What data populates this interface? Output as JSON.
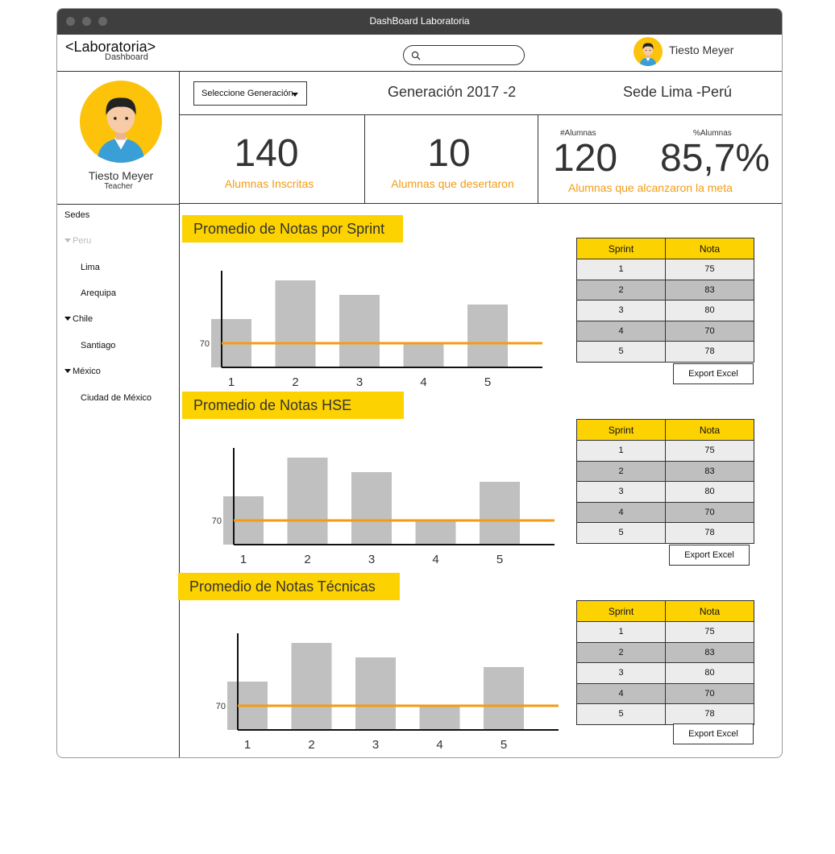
{
  "window": {
    "title": "DashBoard Laboratoria"
  },
  "header": {
    "logo": "<Laboratoria>",
    "logo_sub": "Dashboard",
    "search": {
      "value": "",
      "placeholder": ""
    },
    "user_name": "Tiesto Meyer"
  },
  "sidebar": {
    "profile": {
      "name": "Tiesto Meyer",
      "role": "Teacher"
    },
    "tree": [
      {
        "label": "Sedes",
        "level": 0,
        "expandable": false
      },
      {
        "label": "Peru",
        "level": 0,
        "expandable": true,
        "muted": true
      },
      {
        "label": "Lima",
        "level": 1,
        "expandable": false
      },
      {
        "label": "Arequipa",
        "level": 1,
        "expandable": false
      },
      {
        "label": "Chile",
        "level": 0,
        "expandable": true
      },
      {
        "label": "Santiago",
        "level": 1,
        "expandable": false
      },
      {
        "label": "México",
        "level": 0,
        "expandable": true
      },
      {
        "label": "Ciudad de México",
        "level": 1,
        "expandable": false
      }
    ]
  },
  "toolbar": {
    "select_label": "Seleccione Generación",
    "generation": "Generación 2017 -2",
    "sede": "Sede Lima -Perú"
  },
  "stats": {
    "inscritas": {
      "value": "140",
      "label": "Alumnas Inscritas"
    },
    "desertaron": {
      "value": "10",
      "label": "Alumnas que desertaron"
    },
    "meta": {
      "count_label": "#Alumnas",
      "count": "120",
      "pct_label": "%Alumnas",
      "pct": "85,7%",
      "label": "Alumnas que alcanzaron la meta"
    }
  },
  "colors": {
    "accent": "#fcd200",
    "orange": "#f39c12",
    "bar": "#c0c0c0",
    "titlebar": "#3f3f3f"
  },
  "export_label": "Export Excel",
  "table_headers": [
    "Sprint",
    "Nota"
  ],
  "chart_data": [
    {
      "type": "bar",
      "title": "Promedio de Notas por Sprint",
      "categories": [
        "1",
        "2",
        "3",
        "4",
        "5"
      ],
      "values": [
        75,
        83,
        80,
        70,
        78
      ],
      "reference_line": 70,
      "table": [
        [
          "1",
          "75"
        ],
        [
          "2",
          "83"
        ],
        [
          "3",
          "80"
        ],
        [
          "4",
          "70"
        ],
        [
          "5",
          "78"
        ]
      ]
    },
    {
      "type": "bar",
      "title": "Promedio de Notas HSE",
      "categories": [
        "1",
        "2",
        "3",
        "4",
        "5"
      ],
      "values": [
        75,
        83,
        80,
        70,
        78
      ],
      "reference_line": 70,
      "table": [
        [
          "1",
          "75"
        ],
        [
          "2",
          "83"
        ],
        [
          "3",
          "80"
        ],
        [
          "4",
          "70"
        ],
        [
          "5",
          "78"
        ]
      ]
    },
    {
      "type": "bar",
      "title": "Promedio de Notas Técnicas",
      "categories": [
        "1",
        "2",
        "3",
        "4",
        "5"
      ],
      "values": [
        75,
        83,
        80,
        70,
        78
      ],
      "reference_line": 70,
      "table": [
        [
          "1",
          "75"
        ],
        [
          "2",
          "83"
        ],
        [
          "3",
          "80"
        ],
        [
          "4",
          "70"
        ],
        [
          "5",
          "78"
        ]
      ]
    }
  ]
}
